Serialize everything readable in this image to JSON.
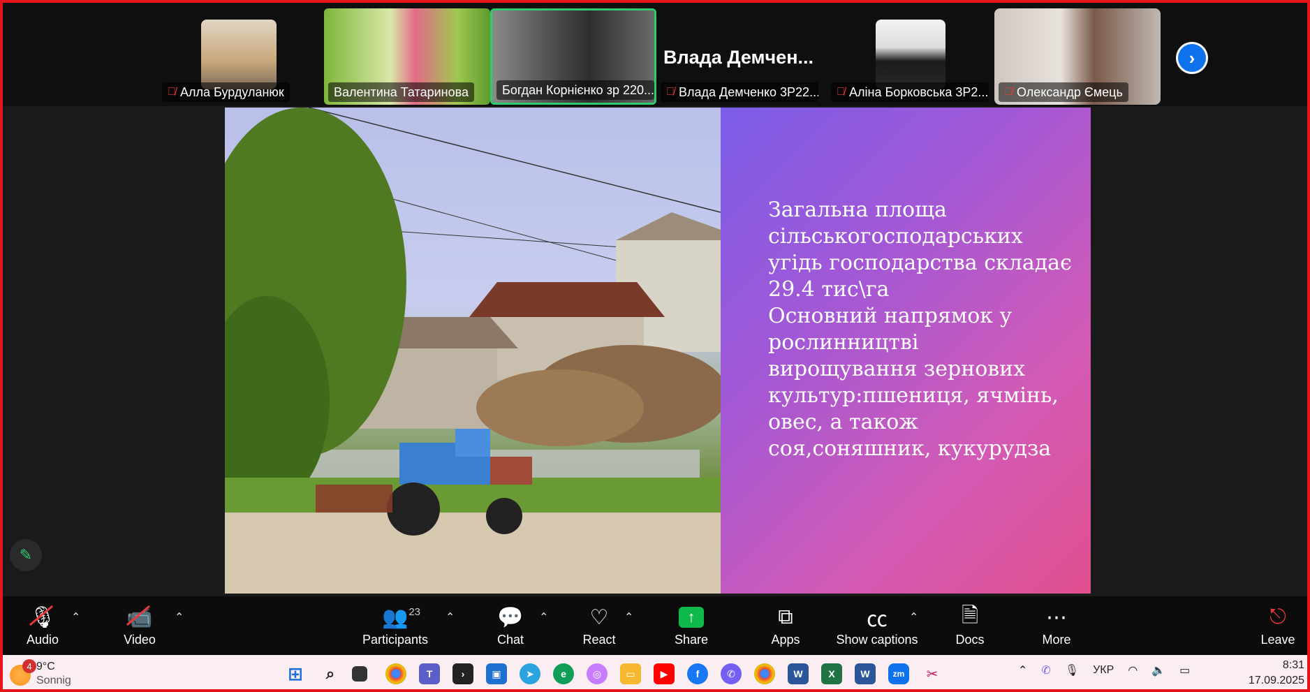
{
  "participants": [
    {
      "name": "Алла Бурдуланюк",
      "muted": true
    },
    {
      "name": "Валентина Татаринова",
      "muted": false
    },
    {
      "name": "Богдан Корнієнко зр 220...",
      "muted": false,
      "active": true
    },
    {
      "name": "Влада Демченко 3Р22...",
      "display_name": "Влада  Демчен...",
      "muted": true
    },
    {
      "name": "Аліна Борковська 3Р2...",
      "muted": true
    },
    {
      "name": "Олександр Ємець",
      "muted": true
    }
  ],
  "slide": {
    "lines": [
      "Загальна площа",
      "сільськогосподарських",
      "угідь господарства складає",
      "29.4 тис\\га",
      "Основний напрямок у",
      "рослинництві",
      "вирощування зернових",
      "культур:пшениця, ячмінь,",
      "овес, а також",
      "соя,соняшник, кукурудза"
    ]
  },
  "toolbar": {
    "audio": "Audio",
    "video": "Video",
    "participants": "Participants",
    "participants_count": "23",
    "chat": "Chat",
    "react": "React",
    "share": "Share",
    "apps": "Apps",
    "captions": "Show captions",
    "docs": "Docs",
    "more": "More",
    "leave": "Leave"
  },
  "taskbar": {
    "weather_temp": "9°C",
    "weather_cond": "Sonnig",
    "weather_badge": "4",
    "language": "УКР",
    "time": "8:31",
    "date": "17.09.2025"
  },
  "colors": {
    "accent": "#0e72ed",
    "share_green": "#10b94b",
    "active_border": "#2ecc71",
    "mute_red": "#e83a3a",
    "window_border": "#e8141c"
  }
}
